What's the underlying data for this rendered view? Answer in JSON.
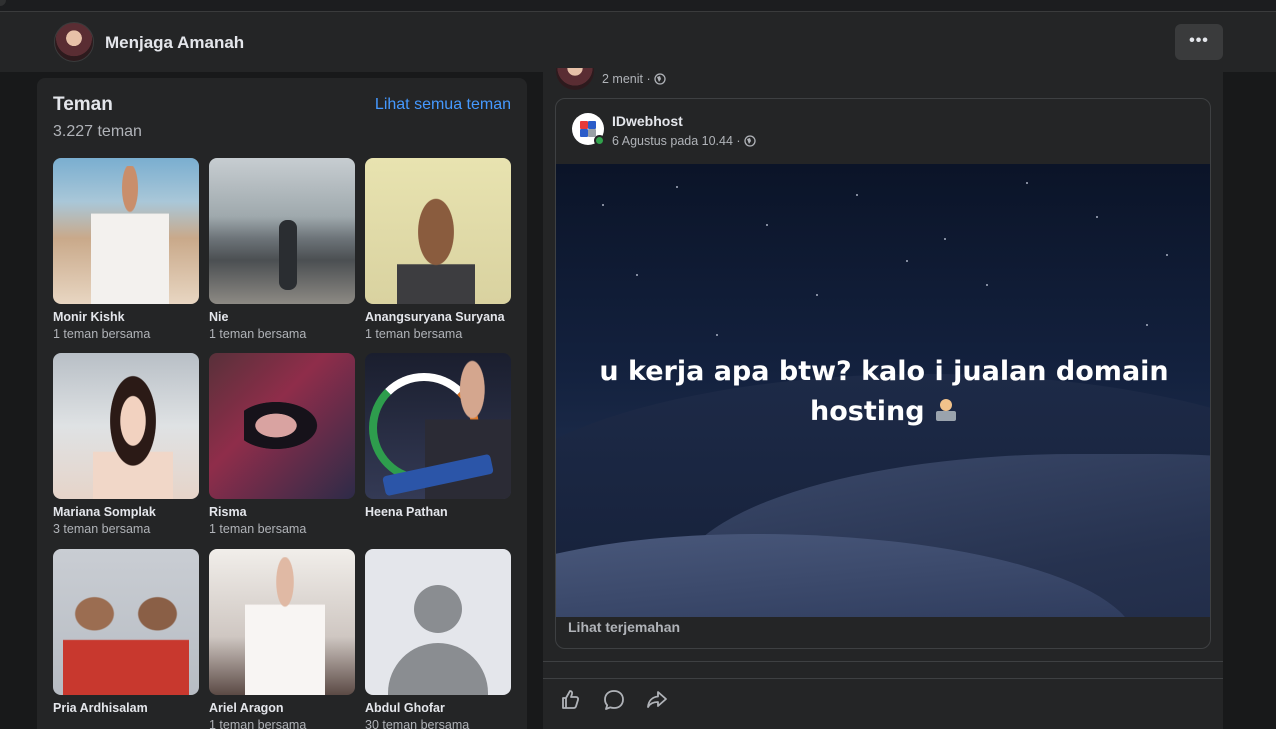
{
  "profile": {
    "name": "Menjaga Amanah",
    "more_label": "•••"
  },
  "friends": {
    "title": "Teman",
    "see_all": "Lihat semua teman",
    "count": "3.227 teman",
    "items": [
      {
        "name": "Monir Kishk",
        "mutual": "1 teman bersama"
      },
      {
        "name": "Nie",
        "mutual": "1 teman bersama"
      },
      {
        "name": "Anangsuryana Suryana",
        "mutual": "1 teman bersama"
      },
      {
        "name": "Mariana Somplak",
        "mutual": "3 teman bersama"
      },
      {
        "name": "Risma",
        "mutual": "1 teman bersama"
      },
      {
        "name": "Heena Pathan",
        "mutual": ""
      },
      {
        "name": "Pria Ardhisalam",
        "mutual": ""
      },
      {
        "name": "Ariel Aragon",
        "mutual": "1 teman bersama"
      },
      {
        "name": "Abdul Ghofar",
        "mutual": "30 teman bersama"
      }
    ]
  },
  "post": {
    "time": "2 menit ·",
    "shared": {
      "page_name": "IDwebhost",
      "date": "6 Agustus pada 10.44 ·",
      "text": "u kerja apa btw? kalo i jualan domain hosting",
      "translate": "Lihat terjemahan"
    }
  },
  "colors": {
    "accent_link": "#4599ff",
    "background": "#18191a",
    "card": "#242526",
    "online": "#31a24c"
  },
  "icons": [
    "globe-icon",
    "like-icon",
    "comment-icon",
    "share-icon",
    "more-icon",
    "laptop-technologist-emoji"
  ]
}
